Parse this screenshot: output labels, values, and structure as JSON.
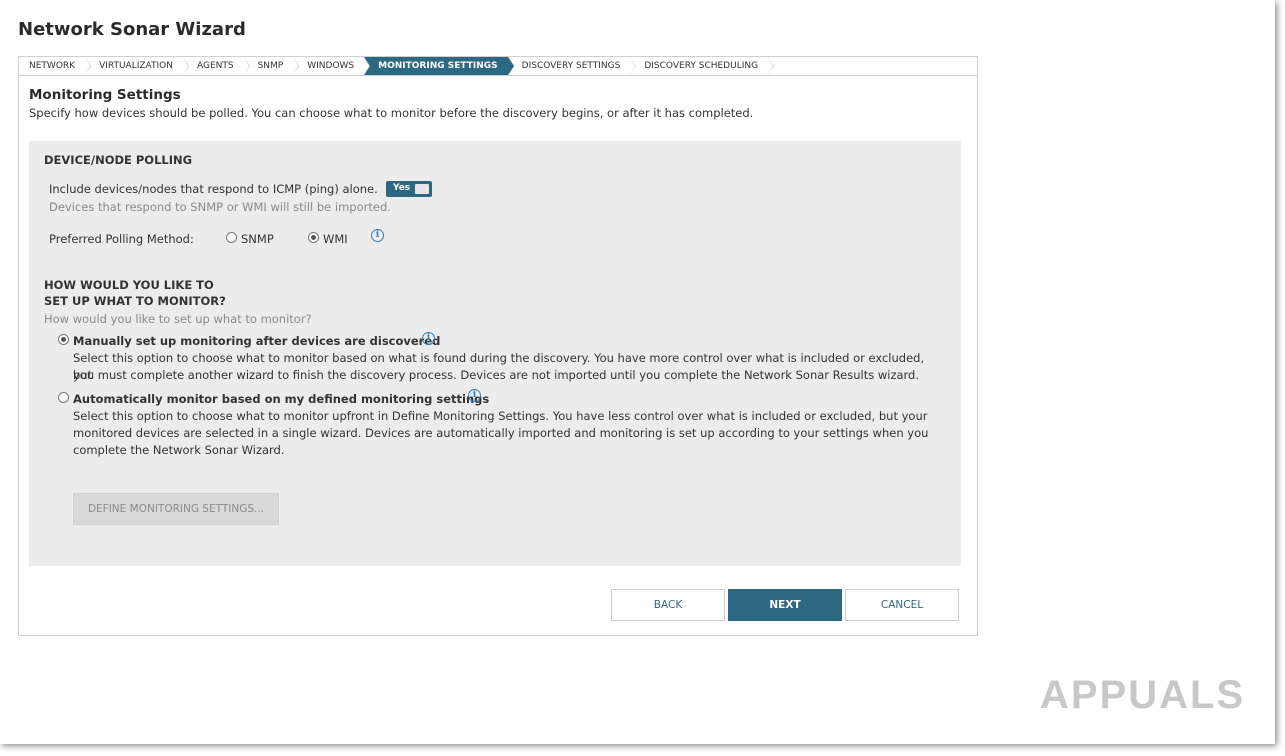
{
  "window": {
    "title": "Network Sonar Wizard"
  },
  "steps": [
    {
      "label": "NETWORK",
      "active": false
    },
    {
      "label": "VIRTUALIZATION",
      "active": false
    },
    {
      "label": "AGENTS",
      "active": false
    },
    {
      "label": "SNMP",
      "active": false
    },
    {
      "label": "WINDOWS",
      "active": false
    },
    {
      "label": "MONITORING SETTINGS",
      "active": true
    },
    {
      "label": "DISCOVERY SETTINGS",
      "active": false
    },
    {
      "label": "DISCOVERY SCHEDULING",
      "active": false
    }
  ],
  "section": {
    "title": "Monitoring Settings",
    "description": "Specify how devices should be polled. You can choose what to monitor before the discovery begins, or after it has completed."
  },
  "polling": {
    "heading": "DEVICE/NODE POLLING",
    "icmp_label": "Include devices/nodes that respond to ICMP (ping) alone.",
    "icmp_toggle": "Yes",
    "icmp_note": "Devices that respond to SNMP or WMI will still be imported.",
    "method_label": "Preferred Polling Method:",
    "options": [
      {
        "label": "SNMP",
        "selected": false
      },
      {
        "label": "WMI",
        "selected": true
      }
    ]
  },
  "monitor": {
    "heading_line1": "HOW WOULD YOU LIKE TO",
    "heading_line2": "SET UP WHAT TO MONITOR?",
    "subheading": "How would you like to set up what to monitor?",
    "options": [
      {
        "title": "Manually set up monitoring after devices are discovered",
        "selected": true,
        "desc_line1": "Select this option to choose what to monitor based on what is found during the discovery. You have more control over what is included or excluded, but",
        "desc_line2": "you must complete another wizard to finish the discovery process. Devices are not imported until you complete the Network Sonar Results wizard."
      },
      {
        "title": "Automatically monitor based on my defined monitoring settings",
        "selected": false,
        "desc_line1": "Select this option to choose what to monitor upfront in Define Monitoring Settings. You have less control over what is included or excluded, but your",
        "desc_line2": "monitored devices are selected in a single wizard. Devices are automatically imported and monitoring is set up according to your settings when you",
        "desc_line3": "complete the Network Sonar Wizard."
      }
    ],
    "define_button": "DEFINE MONITORING SETTINGS..."
  },
  "footer": {
    "back": "BACK",
    "next": "NEXT",
    "cancel": "CANCEL"
  },
  "colors": {
    "accent": "#2d6883",
    "panel_bg": "#ececec",
    "info_icon": "#2f7fb8"
  },
  "watermark": {
    "text": "APPUALS"
  }
}
